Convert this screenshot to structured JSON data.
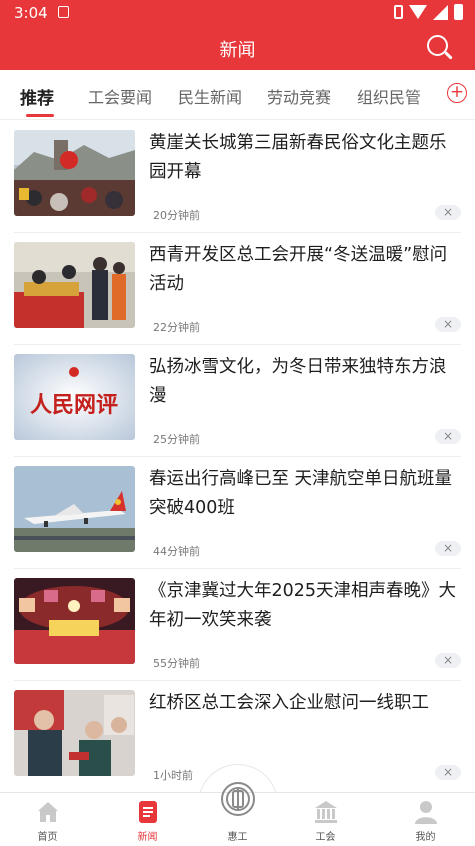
{
  "status_bar": {
    "time": "3:04"
  },
  "header": {
    "title": "新闻"
  },
  "tabs": [
    {
      "label": "推荐",
      "active": true
    },
    {
      "label": "工会要闻"
    },
    {
      "label": "民生新闻"
    },
    {
      "label": "劳动竞赛"
    },
    {
      "label": "组织民管"
    }
  ],
  "add_tab": "⊕",
  "news": [
    {
      "title": "黄崖关长城第三届新春民俗文化主题乐园开幕",
      "time": "20分钟前"
    },
    {
      "title": "西青开发区总工会开展“冬送温暖”慰问活动",
      "time": "22分钟前"
    },
    {
      "title": "弘扬冰雪文化，为冬日带来独特东方浪漫",
      "time": "25分钟前",
      "thumb_text": "人民网评"
    },
    {
      "title": "春运出行高峰已至 天津航空单日航班量突破400班",
      "time": "44分钟前"
    },
    {
      "title": "《京津冀过大年2025天津相声春晚》大年初一欢笑来袭",
      "time": "55分钟前"
    },
    {
      "title": "红桥区总工会深入企业慰问一线职工",
      "time": "1小时前"
    }
  ],
  "close_label": "×",
  "bottom_nav": [
    {
      "label": "首页"
    },
    {
      "label": "新闻",
      "active": true
    },
    {
      "label": "惠工"
    },
    {
      "label": "工会"
    },
    {
      "label": "我的"
    }
  ],
  "colors": {
    "brand_red": "#e8373b",
    "text_dark": "#1e1e1e",
    "text_muted": "#777777"
  }
}
